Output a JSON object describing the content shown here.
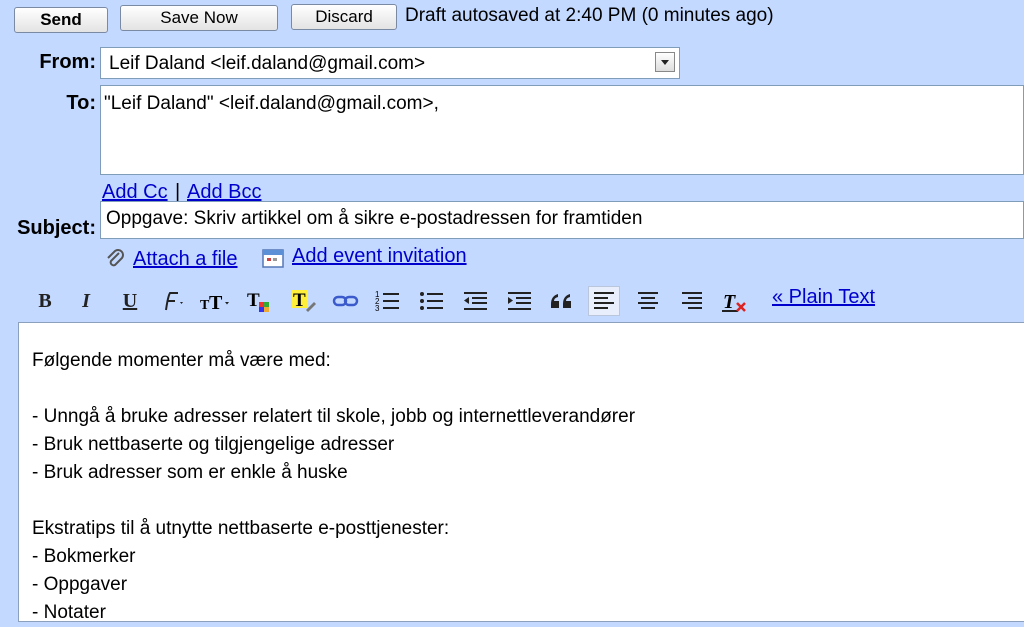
{
  "toolbar": {
    "send_label": "Send",
    "save_label": "Save Now",
    "discard_label": "Discard",
    "status": "Draft autosaved at 2:40 PM (0 minutes ago)"
  },
  "from": {
    "label": "From:",
    "value": "Leif Daland <leif.daland@gmail.com>"
  },
  "to": {
    "label": "To:",
    "value": "\"Leif Daland\" <leif.daland@gmail.com>,"
  },
  "cc_links": {
    "add_cc": "Add Cc",
    "separator": "|",
    "add_bcc": "Add Bcc"
  },
  "subject": {
    "label": "Subject:",
    "value": "Oppgave: Skriv artikkel om å sikre e-postadressen for framtiden"
  },
  "attachments": {
    "attach_label": "Attach a file",
    "event_label": "Add event invitation"
  },
  "format_toolbar": {
    "bold": "B",
    "italic": "I",
    "underline": "U",
    "plain_text_link": "« Plain Text"
  },
  "body_lines": [
    "Følgende momenter må være med:",
    "",
    "- Unngå å bruke adresser relatert til skole, jobb og internettleverandører",
    "- Bruk nettbaserte og tilgjengelige adresser",
    "- Bruk adresser som er enkle å huske",
    "",
    "Ekstratips til å utnytte nettbaserte e-posttjenester:",
    "- Bokmerker",
    "- Oppgaver",
    "- Notater"
  ]
}
